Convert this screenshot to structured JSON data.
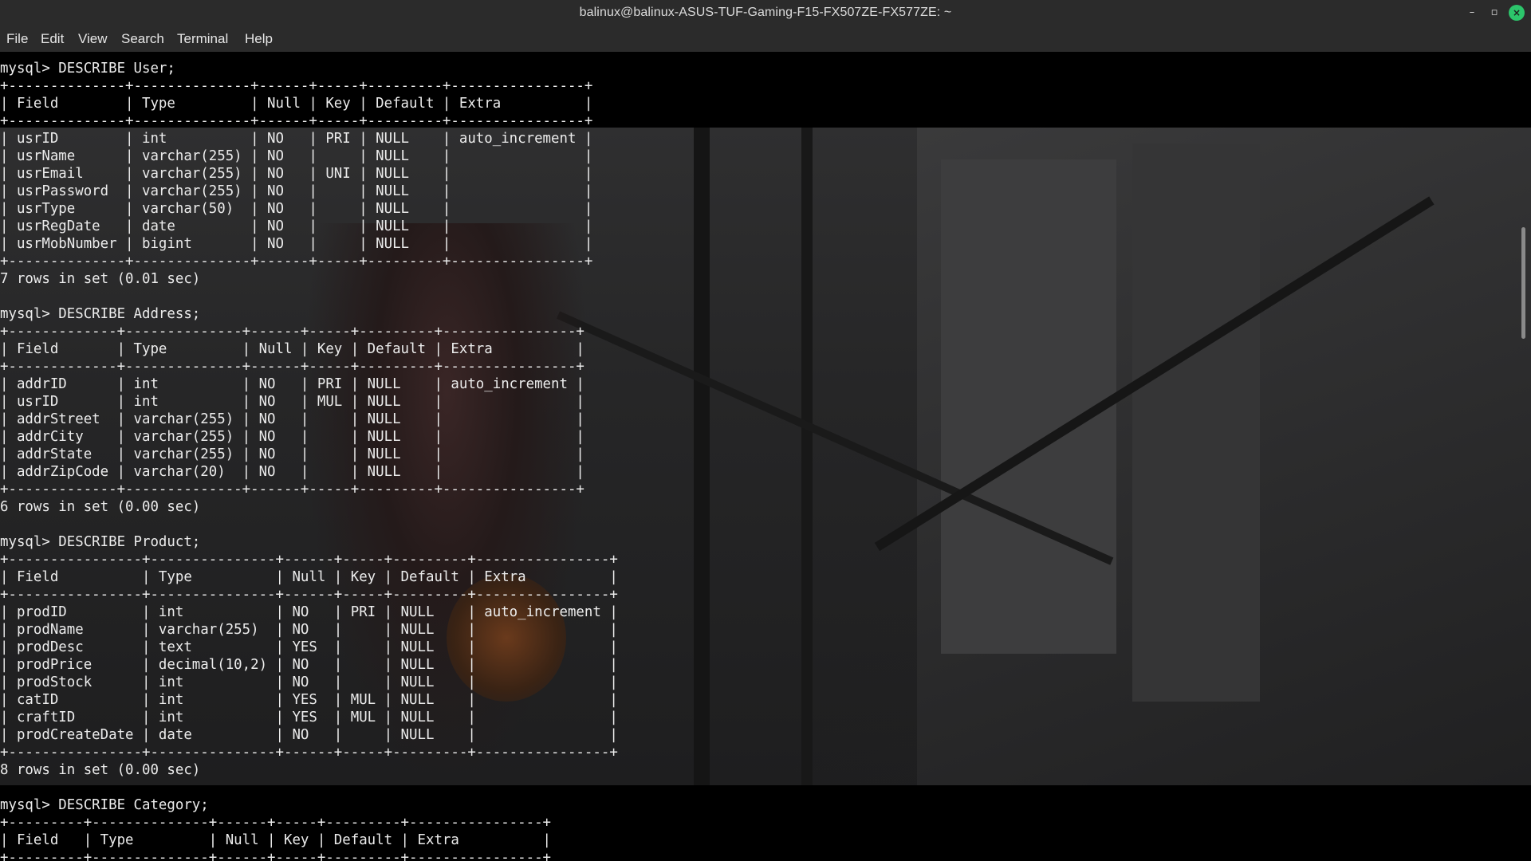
{
  "window": {
    "title": "balinux@balinux-ASUS-TUF-Gaming-F15-FX507ZE-FX577ZE: ~",
    "controls": {
      "minimize": "–",
      "maximize": "▫",
      "close": "×"
    }
  },
  "menu": [
    "File",
    "Edit",
    "View",
    "Search",
    "Terminal",
    "Help"
  ],
  "terminal": {
    "lines": [
      "mysql> DESCRIBE User;",
      "+--------------+--------------+------+-----+---------+----------------+",
      "| Field        | Type         | Null | Key | Default | Extra          |",
      "+--------------+--------------+------+-----+---------+----------------+",
      "| usrID        | int          | NO   | PRI | NULL    | auto_increment |",
      "| usrName      | varchar(255) | NO   |     | NULL    |                |",
      "| usrEmail     | varchar(255) | NO   | UNI | NULL    |                |",
      "| usrPassword  | varchar(255) | NO   |     | NULL    |                |",
      "| usrType      | varchar(50)  | NO   |     | NULL    |                |",
      "| usrRegDate   | date         | NO   |     | NULL    |                |",
      "| usrMobNumber | bigint       | NO   |     | NULL    |                |",
      "+--------------+--------------+------+-----+---------+----------------+",
      "7 rows in set (0.01 sec)",
      "",
      "mysql> DESCRIBE Address;",
      "+-------------+--------------+------+-----+---------+----------------+",
      "| Field       | Type         | Null | Key | Default | Extra          |",
      "+-------------+--------------+------+-----+---------+----------------+",
      "| addrID      | int          | NO   | PRI | NULL    | auto_increment |",
      "| usrID       | int          | NO   | MUL | NULL    |                |",
      "| addrStreet  | varchar(255) | NO   |     | NULL    |                |",
      "| addrCity    | varchar(255) | NO   |     | NULL    |                |",
      "| addrState   | varchar(255) | NO   |     | NULL    |                |",
      "| addrZipCode | varchar(20)  | NO   |     | NULL    |                |",
      "+-------------+--------------+------+-----+---------+----------------+",
      "6 rows in set (0.00 sec)",
      "",
      "mysql> DESCRIBE Product;",
      "+----------------+---------------+------+-----+---------+----------------+",
      "| Field          | Type          | Null | Key | Default | Extra          |",
      "+----------------+---------------+------+-----+---------+----------------+",
      "| prodID         | int           | NO   | PRI | NULL    | auto_increment |",
      "| prodName       | varchar(255)  | NO   |     | NULL    |                |",
      "| prodDesc       | text          | YES  |     | NULL    |                |",
      "| prodPrice      | decimal(10,2) | NO   |     | NULL    |                |",
      "| prodStock      | int           | NO   |     | NULL    |                |",
      "| catID          | int           | YES  | MUL | NULL    |                |",
      "| craftID        | int           | YES  | MUL | NULL    |                |",
      "| prodCreateDate | date          | NO   |     | NULL    |                |",
      "+----------------+---------------+------+-----+---------+----------------+",
      "8 rows in set (0.00 sec)",
      "",
      "mysql> DESCRIBE Category;",
      "+---------+--------------+------+-----+---------+----------------+",
      "| Field   | Type         | Null | Key | Default | Extra          |",
      "+---------+--------------+------+-----+---------+----------------+"
    ]
  }
}
